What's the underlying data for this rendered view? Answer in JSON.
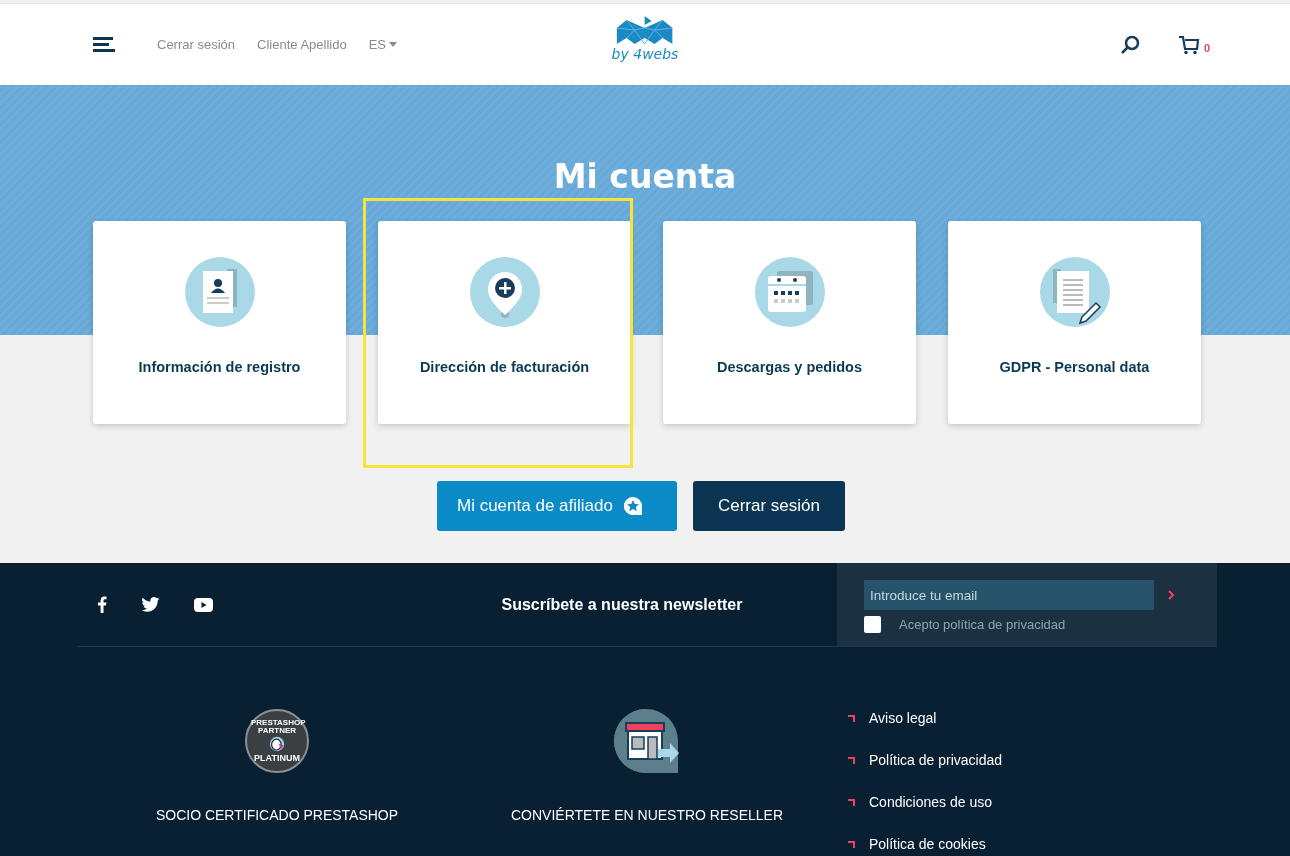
{
  "header": {
    "links": [
      "Cerrar sesión",
      "Cliente Apellido"
    ],
    "language": "ES",
    "logo_text": "by 4webs",
    "cart_count": "0"
  },
  "hero": {
    "title": "Mi cuenta"
  },
  "cards": [
    {
      "label": "Información de registro",
      "kind": "profile",
      "highlighted": false
    },
    {
      "label": "Dirección de facturación",
      "kind": "address",
      "highlighted": true
    },
    {
      "label": "Descargas y pedidos",
      "kind": "calendar",
      "highlighted": false
    },
    {
      "label": "GDPR - Personal data",
      "kind": "document",
      "highlighted": false
    }
  ],
  "buttons": [
    {
      "label": "Mi cuenta de afiliado",
      "kind": "primary"
    },
    {
      "label": "Cerrar sesión",
      "kind": "dark"
    }
  ],
  "footer": {
    "newsletter": {
      "title": "Suscríbete a nuestra newsletter",
      "placeholder": "Introduce tu email",
      "consent": "Acepto política de privacidad",
      "checked": false
    },
    "badges": [
      {
        "kind": "partner",
        "label": "SOCIO CERTIFICADO PRESTASHOP",
        "badge_top": "PRESTASHOP PARTNER",
        "badge_bottom": "PLATINUM"
      },
      {
        "kind": "reseller",
        "label": "CONVIÉRTETE EN NUESTRO RESELLER"
      }
    ],
    "links": [
      "Aviso legal",
      "Política de privacidad",
      "Condiciones de uso",
      "Política de cookies"
    ]
  }
}
